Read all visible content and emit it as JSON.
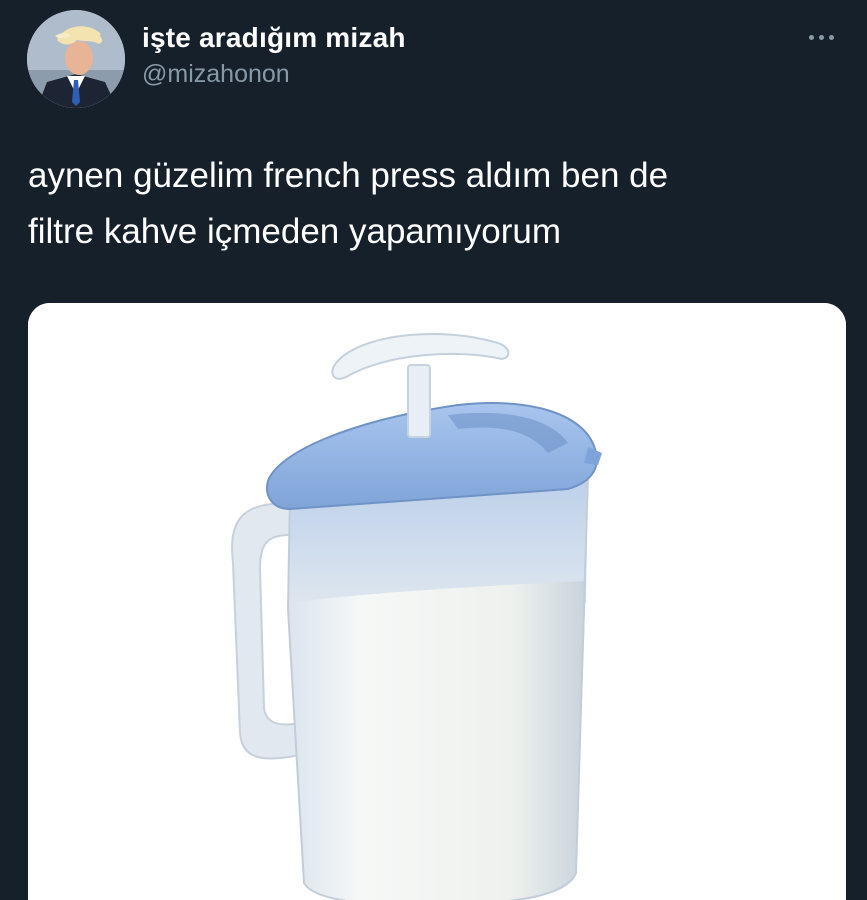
{
  "tweet": {
    "author": {
      "display_name": "işte aradığım mizah",
      "handle": "@mizahonon",
      "avatar_icon": "profile-avatar"
    },
    "more_icon": "more-horizontal-icon",
    "text": "aynen güzelim french press aldım ben de\nfiltre kahve içmeden yapamıyorum",
    "media": {
      "kind": "photo",
      "icon": "plastic-pitcher-with-milk"
    }
  },
  "colors": {
    "background": "#15202b",
    "text_primary": "#ffffff",
    "text_secondary": "#8899a6",
    "lid_blue": "#8eb3e3",
    "milk": "#f4f4ee"
  }
}
